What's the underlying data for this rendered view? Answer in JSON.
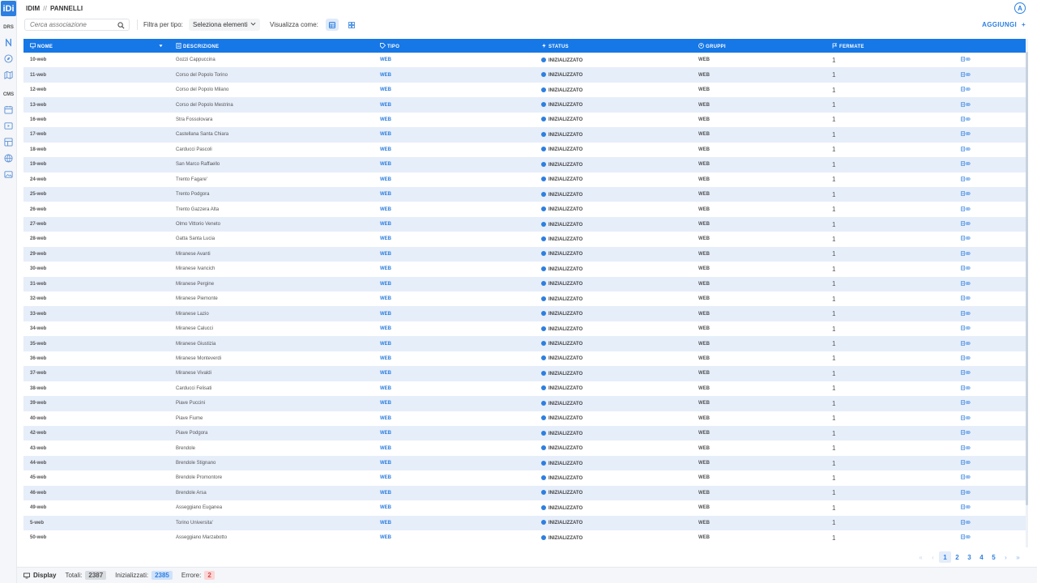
{
  "app": {
    "logo_text": "iDi",
    "breadcrumb_root": "IDIM",
    "breadcrumb_sep": "//",
    "breadcrumb_page": "PANNELLI",
    "avatar_initial": "A",
    "accent_color": "#2d7fe0"
  },
  "rail": {
    "section_drs": "DRS",
    "section_cms": "CMS",
    "icons_drs": [
      "routes-icon",
      "compass-icon",
      "map-icon"
    ],
    "icons_cms": [
      "calendar-icon",
      "media-icon",
      "layout-icon",
      "globe-icon",
      "gallery-icon"
    ]
  },
  "toolbar": {
    "search_placeholder": "Cerca associazione",
    "filter_label": "Filtra per tipo:",
    "filter_value": "Seleziona elementi",
    "view_label": "Visualizza come:",
    "add_label": "AGGIUNGI",
    "add_icon": "+"
  },
  "table": {
    "columns": [
      "NOME",
      "DESCRIZIONE",
      "TIPO",
      "STATUS",
      "GRUPPI",
      "FERMATE"
    ],
    "rows": [
      {
        "nome": "10-web",
        "descrizione": "Gozzi Cappuccina",
        "tipo": "WEB",
        "status": "INIZIALIZZATO",
        "gruppi": "WEB",
        "fermate": "1"
      },
      {
        "nome": "11-web",
        "descrizione": "Corso del Popolo Torino",
        "tipo": "WEB",
        "status": "INIZIALIZZATO",
        "gruppi": "WEB",
        "fermate": "1"
      },
      {
        "nome": "12-web",
        "descrizione": "Corso del Popolo Milano",
        "tipo": "WEB",
        "status": "INIZIALIZZATO",
        "gruppi": "WEB",
        "fermate": "1"
      },
      {
        "nome": "13-web",
        "descrizione": "Corso del Popolo Mestrina",
        "tipo": "WEB",
        "status": "INIZIALIZZATO",
        "gruppi": "WEB",
        "fermate": "1"
      },
      {
        "nome": "16-web",
        "descrizione": "Stra Fossolovara",
        "tipo": "WEB",
        "status": "INIZIALIZZATO",
        "gruppi": "WEB",
        "fermate": "1"
      },
      {
        "nome": "17-web",
        "descrizione": "Castellana Santa Chiara",
        "tipo": "WEB",
        "status": "INIZIALIZZATO",
        "gruppi": "WEB",
        "fermate": "1"
      },
      {
        "nome": "18-web",
        "descrizione": "Carducci Pascoli",
        "tipo": "WEB",
        "status": "INIZIALIZZATO",
        "gruppi": "WEB",
        "fermate": "1"
      },
      {
        "nome": "19-web",
        "descrizione": "San Marco Raffaello",
        "tipo": "WEB",
        "status": "INIZIALIZZATO",
        "gruppi": "WEB",
        "fermate": "1"
      },
      {
        "nome": "24-web",
        "descrizione": "Trento Fagare'",
        "tipo": "WEB",
        "status": "INIZIALIZZATO",
        "gruppi": "WEB",
        "fermate": "1"
      },
      {
        "nome": "25-web",
        "descrizione": "Trento Podgora",
        "tipo": "WEB",
        "status": "INIZIALIZZATO",
        "gruppi": "WEB",
        "fermate": "1"
      },
      {
        "nome": "26-web",
        "descrizione": "Trento Gazzera Alta",
        "tipo": "WEB",
        "status": "INIZIALIZZATO",
        "gruppi": "WEB",
        "fermate": "1"
      },
      {
        "nome": "27-web",
        "descrizione": "Olmo Vittorio Veneto",
        "tipo": "WEB",
        "status": "INIZIALIZZATO",
        "gruppi": "WEB",
        "fermate": "1"
      },
      {
        "nome": "28-web",
        "descrizione": "Gatta Santa Lucia",
        "tipo": "WEB",
        "status": "INIZIALIZZATO",
        "gruppi": "WEB",
        "fermate": "1"
      },
      {
        "nome": "29-web",
        "descrizione": "Miranese Avanti",
        "tipo": "WEB",
        "status": "INIZIALIZZATO",
        "gruppi": "WEB",
        "fermate": "1"
      },
      {
        "nome": "30-web",
        "descrizione": "Miranese Ivancich",
        "tipo": "WEB",
        "status": "INIZIALIZZATO",
        "gruppi": "WEB",
        "fermate": "1"
      },
      {
        "nome": "31-web",
        "descrizione": "Miranese Pergine",
        "tipo": "WEB",
        "status": "INIZIALIZZATO",
        "gruppi": "WEB",
        "fermate": "1"
      },
      {
        "nome": "32-web",
        "descrizione": "Miranese Piemonte",
        "tipo": "WEB",
        "status": "INIZIALIZZATO",
        "gruppi": "WEB",
        "fermate": "1"
      },
      {
        "nome": "33-web",
        "descrizione": "Miranese Lazio",
        "tipo": "WEB",
        "status": "INIZIALIZZATO",
        "gruppi": "WEB",
        "fermate": "1"
      },
      {
        "nome": "34-web",
        "descrizione": "Miranese Calucci",
        "tipo": "WEB",
        "status": "INIZIALIZZATO",
        "gruppi": "WEB",
        "fermate": "1"
      },
      {
        "nome": "35-web",
        "descrizione": "Miranese Giustizia",
        "tipo": "WEB",
        "status": "INIZIALIZZATO",
        "gruppi": "WEB",
        "fermate": "1"
      },
      {
        "nome": "36-web",
        "descrizione": "Miranese Monteverdi",
        "tipo": "WEB",
        "status": "INIZIALIZZATO",
        "gruppi": "WEB",
        "fermate": "1"
      },
      {
        "nome": "37-web",
        "descrizione": "Miranese Vivaldi",
        "tipo": "WEB",
        "status": "INIZIALIZZATO",
        "gruppi": "WEB",
        "fermate": "1"
      },
      {
        "nome": "38-web",
        "descrizione": "Carducci Felisati",
        "tipo": "WEB",
        "status": "INIZIALIZZATO",
        "gruppi": "WEB",
        "fermate": "1"
      },
      {
        "nome": "39-web",
        "descrizione": "Piave Puccini",
        "tipo": "WEB",
        "status": "INIZIALIZZATO",
        "gruppi": "WEB",
        "fermate": "1"
      },
      {
        "nome": "40-web",
        "descrizione": "Piave Fiume",
        "tipo": "WEB",
        "status": "INIZIALIZZATO",
        "gruppi": "WEB",
        "fermate": "1"
      },
      {
        "nome": "42-web",
        "descrizione": "Piave Podgora",
        "tipo": "WEB",
        "status": "INIZIALIZZATO",
        "gruppi": "WEB",
        "fermate": "1"
      },
      {
        "nome": "43-web",
        "descrizione": "Brendole",
        "tipo": "WEB",
        "status": "INIZIALIZZATO",
        "gruppi": "WEB",
        "fermate": "1"
      },
      {
        "nome": "44-web",
        "descrizione": "Brendole Stignano",
        "tipo": "WEB",
        "status": "INIZIALIZZATO",
        "gruppi": "WEB",
        "fermate": "1"
      },
      {
        "nome": "45-web",
        "descrizione": "Brendole Promontore",
        "tipo": "WEB",
        "status": "INIZIALIZZATO",
        "gruppi": "WEB",
        "fermate": "1"
      },
      {
        "nome": "46-web",
        "descrizione": "Brendole Arsa",
        "tipo": "WEB",
        "status": "INIZIALIZZATO",
        "gruppi": "WEB",
        "fermate": "1"
      },
      {
        "nome": "49-web",
        "descrizione": "Asseggiano Euganea",
        "tipo": "WEB",
        "status": "INIZIALIZZATO",
        "gruppi": "WEB",
        "fermate": "1"
      },
      {
        "nome": "5-web",
        "descrizione": "Torino Universita'",
        "tipo": "WEB",
        "status": "INIZIALIZZATO",
        "gruppi": "WEB",
        "fermate": "1"
      },
      {
        "nome": "50-web",
        "descrizione": "Asseggiano Marzabotto",
        "tipo": "WEB",
        "status": "INIZIALIZZATO",
        "gruppi": "WEB",
        "fermate": "1"
      }
    ]
  },
  "pagination": {
    "first": "«",
    "prev": "‹",
    "pages": [
      "1",
      "2",
      "3",
      "4",
      "5"
    ],
    "current": "1",
    "next": "›",
    "last": "»"
  },
  "footer": {
    "display_label": "Display",
    "totali_label": "Totali:",
    "totali_value": "2387",
    "inizializzati_label": "Inizializzati:",
    "inizializzati_value": "2385",
    "errore_label": "Errore:",
    "errore_value": "2"
  }
}
